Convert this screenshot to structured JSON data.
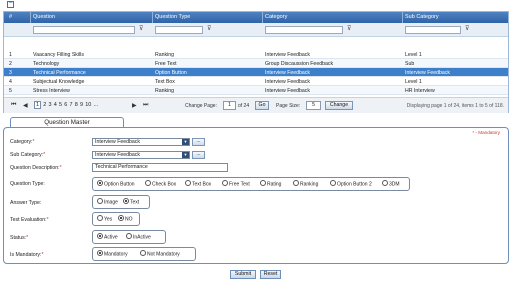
{
  "collapse_icon": "collapse-minus-icon",
  "grid": {
    "headers": {
      "num": "#",
      "question": "Question",
      "type": "Question Type",
      "category": "Category",
      "subcategory": "Sub Category"
    },
    "rows": [
      {
        "num": "1",
        "question": "Vaacancy Filling Skills",
        "type": "Ranking",
        "category": "Interview Feedback",
        "subcategory": "Level 1"
      },
      {
        "num": "2",
        "question": "Technology",
        "type": "Free Text",
        "category": "Group Discaussion Feedback",
        "subcategory": "Sub"
      },
      {
        "num": "3",
        "question": "Technical Performance",
        "type": "Option Button",
        "category": "Interview Feedback",
        "subcategory": "Interview Feedback"
      },
      {
        "num": "4",
        "question": "Subjectual Knowledge",
        "type": "Text Box",
        "category": "Interview Feedback",
        "subcategory": "Level 1"
      },
      {
        "num": "5",
        "question": "Stress Interview",
        "type": "Ranking",
        "category": "Interview Feedback",
        "subcategory": "HR Interview"
      }
    ],
    "selected_row": 2
  },
  "pager": {
    "pages": [
      "1",
      "2",
      "3",
      "4",
      "5",
      "6",
      "7",
      "8",
      "9",
      "10",
      "..."
    ],
    "change_page_label": "Change Page:",
    "page_value": "1",
    "of_label": "of 24",
    "go_label": "Go",
    "page_size_label": "Page Size:",
    "page_size_value": "5",
    "change_label": "Change",
    "info": "Displaying page 1 of 24, items 1 to 5 of 118."
  },
  "form": {
    "tab_title": "Question Master",
    "mandatory_note": "* - Mandatory",
    "category_label": "Category:",
    "category_value": "Interview Feedback",
    "subcategory_label": "Sub Category:",
    "subcategory_value": "Interview Feedback",
    "dots_label": "...",
    "description_label": "Question Description:",
    "description_value": "Technical Performance",
    "question_type_label": "Question Type:",
    "question_type_options": [
      "Option Button",
      "Check Box",
      "Text Box",
      "Free Text",
      "Rating",
      "Ranking",
      "Option Button 2",
      "3DM"
    ],
    "question_type_selected": "Option Button",
    "answer_type_label": "Answer Type:",
    "answer_type_options": [
      "Image",
      "Text"
    ],
    "answer_type_selected": "Text",
    "test_eval_label": "Test Evaluation:",
    "test_eval_options": [
      "Yes",
      "NO"
    ],
    "test_eval_selected": "NO",
    "status_label": "Status:",
    "status_options": [
      "Active",
      "InActive"
    ],
    "status_selected": "Active",
    "mandatory_label": "Is Mandatory:",
    "mandatory_options": [
      "Mandatory",
      "Not Mandatory"
    ],
    "mandatory_selected": "Mandatory",
    "required_mark": "*"
  },
  "buttons": {
    "submit": "Submit",
    "reset": "Reset"
  }
}
